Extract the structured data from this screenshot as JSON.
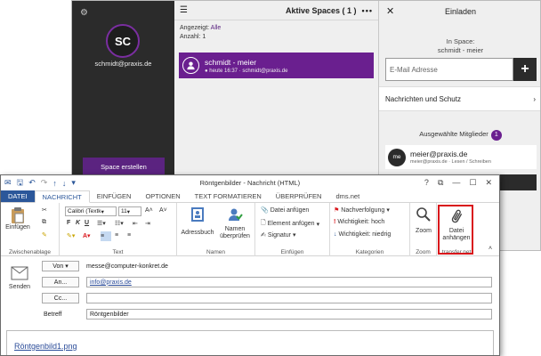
{
  "spaces": {
    "avatar_initials": "SC",
    "user_email": "schmidt@praxis.de",
    "create_button": "Space erstellen",
    "header_title": "Aktive Spaces ( 1 )",
    "shown_label": "Angezeigt:",
    "shown_value": "Alle",
    "count_label": "Anzahl:",
    "count_value": "1",
    "space_name": "schmidt - meier",
    "space_sub": "heute 16:37 · schmidt@praxis.de"
  },
  "invite": {
    "title": "Einladen",
    "in_space_label": "In Space:",
    "in_space_value": "schmidt - meier",
    "email_placeholder": "E-Mail Adresse",
    "messages_protection": "Nachrichten und Schutz",
    "selected_members": "Ausgewählte Mitglieder",
    "member_count": "1",
    "member_initials": "me",
    "member_email": "meier@praxis.de",
    "member_role": "meier@praxis.de · Lesen / Schreiben"
  },
  "outlook": {
    "window_title": "Röntgenbilder - Nachricht (HTML)",
    "window_help": "?",
    "tabs": [
      "DATEI",
      "NACHRICHT",
      "EINFÜGEN",
      "OPTIONEN",
      "TEXT FORMATIEREN",
      "ÜBERPRÜFEN",
      "dms.net"
    ],
    "ribbon": {
      "paste": "Einfügen",
      "clipboard_group": "Zwischenablage",
      "font_name": "Calibri (Textk",
      "font_size": "11",
      "text_group": "Text",
      "address_book": "Adressbuch",
      "check_names": "Namen überprüfen",
      "names_group": "Namen",
      "attach_file": "Datei anfügen",
      "attach_item": "Element anfügen",
      "signature": "Signatur",
      "insert_group": "Einfügen",
      "follow_up": "Nachverfolgung",
      "high_importance": "Wichtigkeit: hoch",
      "low_importance": "Wichtigkeit: niedrig",
      "categories_group": "Kategorien",
      "zoom": "Zoom",
      "zoom_group": "Zoom",
      "attach_file_big": "Datei anhängen",
      "transfer_group": "transfer.net"
    },
    "compose": {
      "send": "Senden",
      "from_button": "Von",
      "from_value": "messe@computer-konkret.de",
      "to_button": "An...",
      "to_value": "info@praxis.de",
      "cc_button": "Cc...",
      "cc_value": "",
      "subject_label": "Betreff",
      "subject_value": "Röntgenbilder",
      "attachment": "Röntgenbild1.png"
    }
  }
}
